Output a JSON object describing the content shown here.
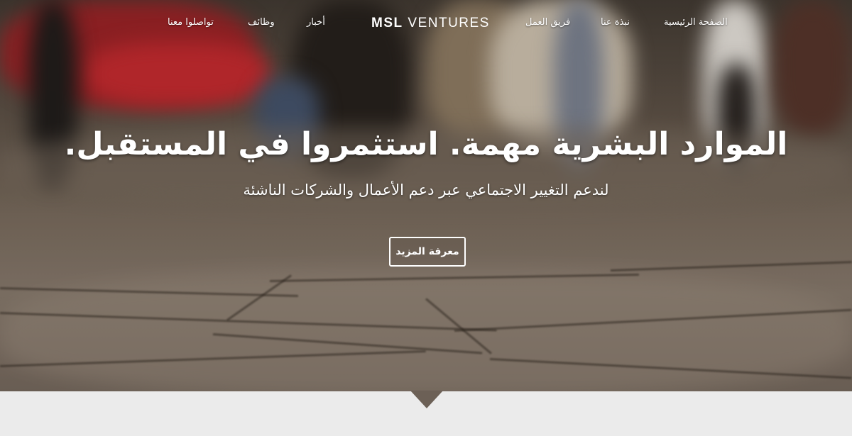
{
  "nav": {
    "home": "الصفحة الرئيسية",
    "about": "نبذة عنا",
    "team": "فريق العمل",
    "news": "أخبار",
    "jobs": "وظائف",
    "contact": "تواصلوا معنا"
  },
  "logo": {
    "bold": "MSL",
    "rest": "VENTURES"
  },
  "hero": {
    "headline": "الموارد البشرية مهمة. استثمروا في المستقبل.",
    "subheadline": "لندعم التغيير الاجتماعي عبر دعم الأعمال والشركات الناشئة",
    "cta_label": "معرفة المزيد"
  }
}
